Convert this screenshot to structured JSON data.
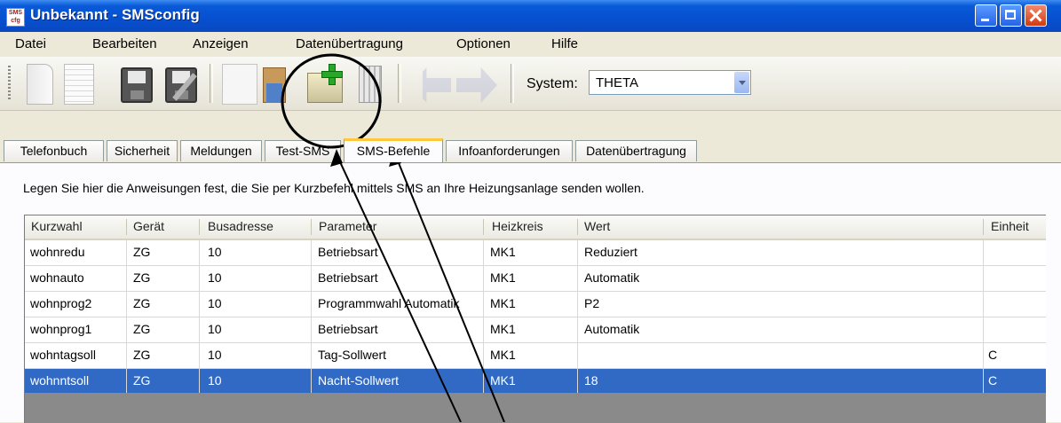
{
  "window": {
    "title": "Unbekannt - SMSconfig",
    "app_icon_text": "SMS config"
  },
  "menu": [
    {
      "label": "Datei"
    },
    {
      "label": "Bearbeiten"
    },
    {
      "label": "Anzeigen"
    },
    {
      "label": "Datenübertragung"
    },
    {
      "label": "Optionen"
    },
    {
      "label": "Hilfe"
    }
  ],
  "toolbar": {
    "icons": [
      "new-document-icon",
      "page-icon",
      "save-icon",
      "save-as-icon",
      "copy-icon",
      "paste-icon",
      "add-entry-icon",
      "delete-icon",
      "back-icon",
      "forward-icon"
    ],
    "system_label": "System:",
    "system_value": "THETA"
  },
  "tabs": [
    {
      "label": "Telefonbuch"
    },
    {
      "label": "Sicherheit"
    },
    {
      "label": "Meldungen"
    },
    {
      "label": "Test-SMS"
    },
    {
      "label": "SMS-Befehle",
      "active": true
    },
    {
      "label": "Infoanforderungen"
    },
    {
      "label": "Datenübertragung"
    }
  ],
  "instruction": "Legen Sie hier die Anweisungen fest, die Sie per Kurzbefehl mittels SMS an Ihre Heizungsanlage senden wollen.",
  "table": {
    "columns": [
      "Kurzwahl",
      "Gerät",
      "Busadresse",
      "Parameter",
      "Heizkreis",
      "Wert",
      "Einheit"
    ],
    "rows": [
      [
        "wohnredu",
        "ZG",
        "10",
        "Betriebsart",
        "MK1",
        "Reduziert",
        ""
      ],
      [
        "wohnauto",
        "ZG",
        "10",
        "Betriebsart",
        "MK1",
        "Automatik",
        ""
      ],
      [
        "wohnprog2",
        "ZG",
        "10",
        "Programmwahl Automatik",
        "MK1",
        "P2",
        ""
      ],
      [
        "wohnprog1",
        "ZG",
        "10",
        "Betriebsart",
        "MK1",
        "Automatik",
        ""
      ],
      [
        "wohntagsoll",
        "ZG",
        "10",
        "Tag-Sollwert",
        "MK1",
        "",
        "C"
      ],
      [
        "wohnntsoll",
        "ZG",
        "10",
        "Nacht-Sollwert",
        "MK1",
        "18",
        "C"
      ]
    ],
    "selected_row": 5
  },
  "colors": {
    "titlebar": "#0550d0",
    "selection": "#316ac5",
    "active_tab_accent": "#ffc83c"
  }
}
